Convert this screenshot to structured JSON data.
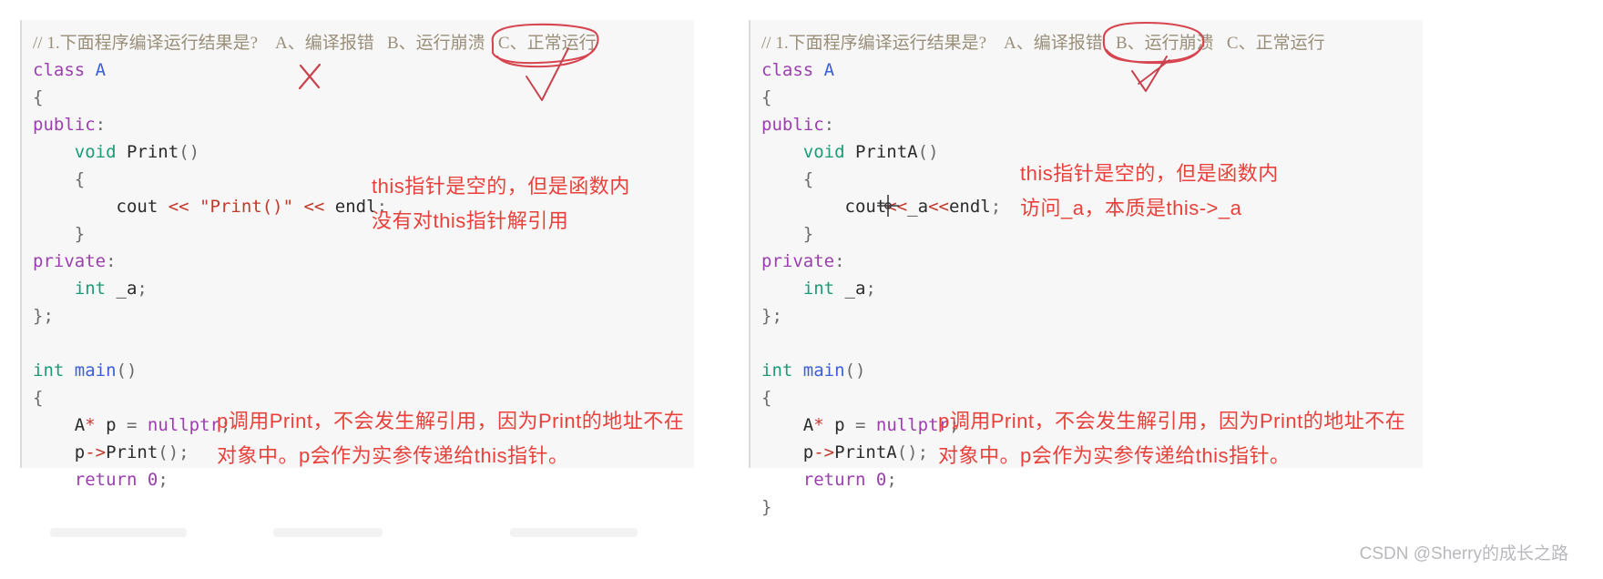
{
  "colors": {
    "panel_bg": "#f7f7f7",
    "annotation_red": "#e8413c",
    "ink_red": "#d64550",
    "comment": "#9a8f7a",
    "keyword": "#9b3fae",
    "type": "#1f9a78",
    "class": "#3a5fd9",
    "string": "#c0392b",
    "watermark": "#b9b9bd"
  },
  "question": {
    "comment_prefix": "// ",
    "number": "1.",
    "text": "下面程序编译运行结果是?",
    "options": [
      {
        "key": "A、",
        "label": "编译报错"
      },
      {
        "key": "B、",
        "label": "运行崩溃"
      },
      {
        "key": "C、",
        "label": "正常运行"
      }
    ]
  },
  "left_panel": {
    "name": "left-code-panel",
    "marked_option": "C",
    "marks": [
      "circle-around-option-C",
      "red-x-cross",
      "red-check-mark"
    ],
    "code_lines": [
      {
        "tokens": [
          {
            "t": "comment",
            "v": "// "
          },
          {
            "t": "comment-cn",
            "v": "1.下面程序编译运行结果是?    "
          },
          {
            "t": "opt",
            "v": "A、编译报错   B、运行崩溃   C、正常运行"
          }
        ]
      },
      {
        "tokens": [
          {
            "t": "kw",
            "v": "class"
          },
          {
            "t": "plain",
            "v": " "
          },
          {
            "t": "cls",
            "v": "A"
          }
        ]
      },
      {
        "tokens": [
          {
            "t": "punct",
            "v": "{"
          }
        ]
      },
      {
        "tokens": [
          {
            "t": "kw",
            "v": "public"
          },
          {
            "t": "punct",
            "v": ":"
          }
        ]
      },
      {
        "tokens": [
          {
            "t": "plain",
            "v": "    "
          },
          {
            "t": "type",
            "v": "void"
          },
          {
            "t": "plain",
            "v": " "
          },
          {
            "t": "fn",
            "v": "Print"
          },
          {
            "t": "punct",
            "v": "()"
          }
        ]
      },
      {
        "tokens": [
          {
            "t": "plain",
            "v": "    "
          },
          {
            "t": "punct",
            "v": "{"
          }
        ]
      },
      {
        "tokens": [
          {
            "t": "plain",
            "v": "        cout "
          },
          {
            "t": "op",
            "v": "<<"
          },
          {
            "t": "plain",
            "v": " "
          },
          {
            "t": "str",
            "v": "\"Print()\""
          },
          {
            "t": "plain",
            "v": " "
          },
          {
            "t": "op",
            "v": "<<"
          },
          {
            "t": "plain",
            "v": " endl"
          },
          {
            "t": "punct",
            "v": ";"
          }
        ]
      },
      {
        "tokens": [
          {
            "t": "plain",
            "v": "    "
          },
          {
            "t": "punct",
            "v": "}"
          }
        ]
      },
      {
        "tokens": [
          {
            "t": "kw",
            "v": "private"
          },
          {
            "t": "punct",
            "v": ":"
          }
        ]
      },
      {
        "tokens": [
          {
            "t": "plain",
            "v": "    "
          },
          {
            "t": "type",
            "v": "int"
          },
          {
            "t": "plain",
            "v": " _a"
          },
          {
            "t": "punct",
            "v": ";"
          }
        ]
      },
      {
        "tokens": [
          {
            "t": "punct",
            "v": "};"
          }
        ]
      },
      {
        "tokens": []
      },
      {
        "tokens": [
          {
            "t": "type",
            "v": "int"
          },
          {
            "t": "plain",
            "v": " "
          },
          {
            "t": "cls",
            "v": "main"
          },
          {
            "t": "punct",
            "v": "()"
          }
        ]
      },
      {
        "tokens": [
          {
            "t": "punct",
            "v": "{"
          }
        ]
      },
      {
        "tokens": [
          {
            "t": "plain",
            "v": "    "
          },
          {
            "t": "cls2",
            "v": "A"
          },
          {
            "t": "op",
            "v": "*"
          },
          {
            "t": "plain",
            "v": " p "
          },
          {
            "t": "op2",
            "v": "="
          },
          {
            "t": "plain",
            "v": " "
          },
          {
            "t": "lit",
            "v": "nullptr"
          },
          {
            "t": "punct",
            "v": ";"
          }
        ]
      },
      {
        "tokens": [
          {
            "t": "plain",
            "v": "    p"
          },
          {
            "t": "op",
            "v": "->"
          },
          {
            "t": "fn",
            "v": "Print"
          },
          {
            "t": "punct",
            "v": "();"
          }
        ]
      },
      {
        "tokens": [
          {
            "t": "plain",
            "v": "    "
          },
          {
            "t": "kw",
            "v": "return"
          },
          {
            "t": "plain",
            "v": " "
          },
          {
            "t": "lit",
            "v": "0"
          },
          {
            "t": "punct",
            "v": ";"
          }
        ]
      }
    ],
    "annotation_top": "this指针是空的，但是函数内\n没有对this指针解引用",
    "annotation_bottom": "p调用Print，不会发生解引用，因为Print的地址不在\n对象中。p会作为实参传递给this指针。"
  },
  "right_panel": {
    "name": "right-code-panel",
    "marked_option": "B",
    "marks": [
      "circle-around-option-B",
      "red-check-mark",
      "crosshair-cursor"
    ],
    "code_lines": [
      {
        "tokens": [
          {
            "t": "comment",
            "v": "// "
          },
          {
            "t": "comment-cn",
            "v": "1.下面程序编译运行结果是?    "
          },
          {
            "t": "opt",
            "v": "A、编译报错   B、运行崩溃   C、正常运行"
          }
        ]
      },
      {
        "tokens": [
          {
            "t": "kw",
            "v": "class"
          },
          {
            "t": "plain",
            "v": " "
          },
          {
            "t": "cls",
            "v": "A"
          }
        ]
      },
      {
        "tokens": [
          {
            "t": "punct",
            "v": "{"
          }
        ]
      },
      {
        "tokens": [
          {
            "t": "kw",
            "v": "public"
          },
          {
            "t": "punct",
            "v": ":"
          }
        ]
      },
      {
        "tokens": [
          {
            "t": "plain",
            "v": "    "
          },
          {
            "t": "type",
            "v": "void"
          },
          {
            "t": "plain",
            "v": " "
          },
          {
            "t": "fn",
            "v": "PrintA"
          },
          {
            "t": "punct",
            "v": "()"
          }
        ]
      },
      {
        "tokens": [
          {
            "t": "plain",
            "v": "    "
          },
          {
            "t": "punct",
            "v": "{"
          }
        ]
      },
      {
        "tokens": [
          {
            "t": "plain",
            "v": "        cout"
          },
          {
            "t": "op",
            "v": "<<"
          },
          {
            "t": "plain",
            "v": "_a"
          },
          {
            "t": "op",
            "v": "<<"
          },
          {
            "t": "plain",
            "v": "endl"
          },
          {
            "t": "punct",
            "v": ";"
          }
        ]
      },
      {
        "tokens": [
          {
            "t": "plain",
            "v": "    "
          },
          {
            "t": "punct",
            "v": "}"
          }
        ]
      },
      {
        "tokens": [
          {
            "t": "kw",
            "v": "private"
          },
          {
            "t": "punct",
            "v": ":"
          }
        ]
      },
      {
        "tokens": [
          {
            "t": "plain",
            "v": "    "
          },
          {
            "t": "type",
            "v": "int"
          },
          {
            "t": "plain",
            "v": " _a"
          },
          {
            "t": "punct",
            "v": ";"
          }
        ]
      },
      {
        "tokens": [
          {
            "t": "punct",
            "v": "};"
          }
        ]
      },
      {
        "tokens": []
      },
      {
        "tokens": [
          {
            "t": "type",
            "v": "int"
          },
          {
            "t": "plain",
            "v": " "
          },
          {
            "t": "cls",
            "v": "main"
          },
          {
            "t": "punct",
            "v": "()"
          }
        ]
      },
      {
        "tokens": [
          {
            "t": "punct",
            "v": "{"
          }
        ]
      },
      {
        "tokens": [
          {
            "t": "plain",
            "v": "    "
          },
          {
            "t": "cls2",
            "v": "A"
          },
          {
            "t": "op",
            "v": "*"
          },
          {
            "t": "plain",
            "v": " p "
          },
          {
            "t": "op2",
            "v": "="
          },
          {
            "t": "plain",
            "v": " "
          },
          {
            "t": "lit",
            "v": "nullptr"
          },
          {
            "t": "punct",
            "v": ";"
          }
        ]
      },
      {
        "tokens": [
          {
            "t": "plain",
            "v": "    p"
          },
          {
            "t": "op",
            "v": "->"
          },
          {
            "t": "fn",
            "v": "PrintA"
          },
          {
            "t": "punct",
            "v": "();"
          }
        ]
      },
      {
        "tokens": [
          {
            "t": "plain",
            "v": "    "
          },
          {
            "t": "kw",
            "v": "return"
          },
          {
            "t": "plain",
            "v": " "
          },
          {
            "t": "lit",
            "v": "0"
          },
          {
            "t": "punct",
            "v": ";"
          }
        ]
      },
      {
        "tokens": [
          {
            "t": "punct",
            "v": "}"
          }
        ]
      }
    ],
    "annotation_top": "this指针是空的，但是函数内\n访问_a，本质是this->_a",
    "annotation_bottom": "p调用Print，不会发生解引用，因为Print的地址不在\n对象中。p会作为实参传递给this指针。"
  },
  "watermark": "CSDN @Sherry的成长之路"
}
